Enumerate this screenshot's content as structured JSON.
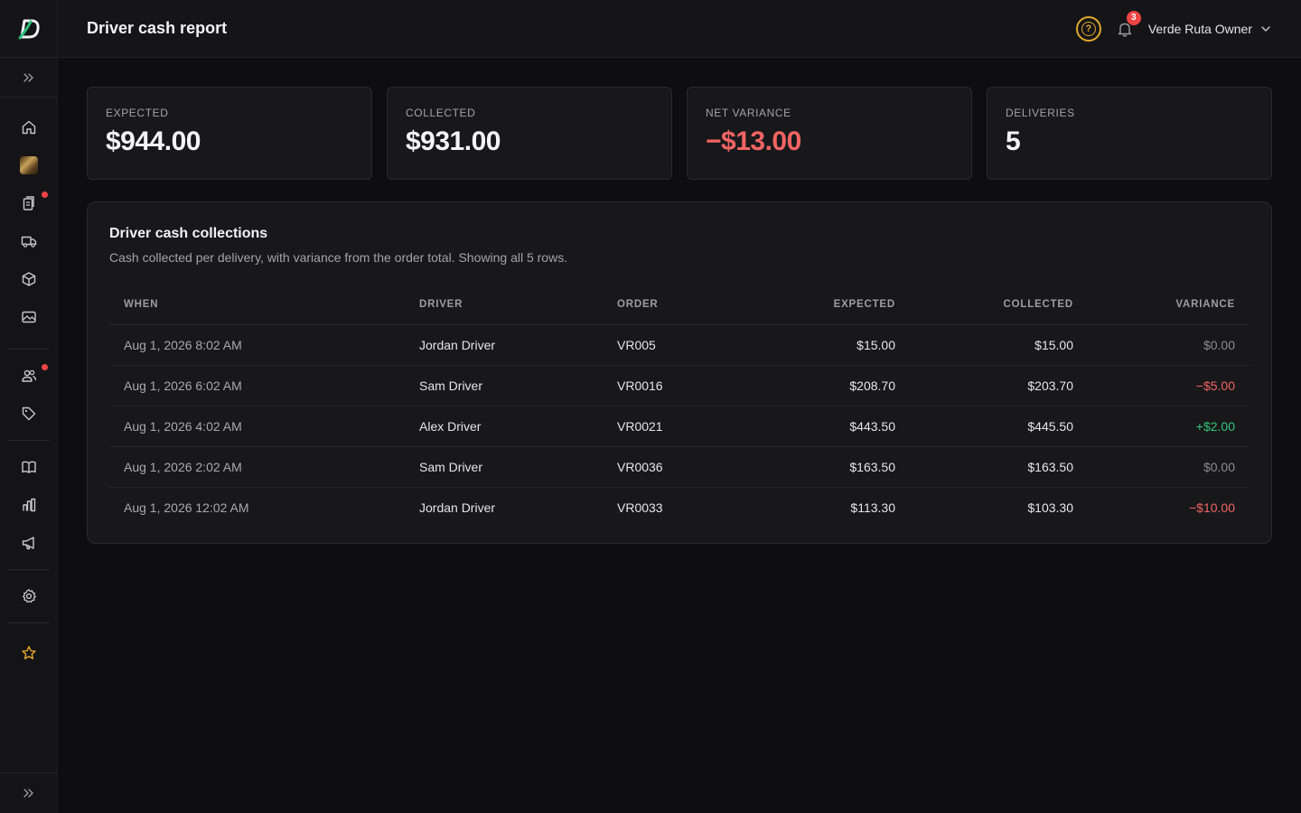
{
  "header": {
    "title": "Driver cash report",
    "notification_count": "3",
    "user_name": "Verde Ruta Owner"
  },
  "sidebar": {
    "items": [
      {
        "name": "home-icon"
      },
      {
        "name": "store-avatar"
      },
      {
        "name": "orders-icon",
        "has_dot": true
      },
      {
        "name": "delivery-truck-icon"
      },
      {
        "name": "products-box-icon"
      },
      {
        "name": "media-image-icon"
      },
      {
        "name": "customers-users-icon",
        "has_dot": true
      },
      {
        "name": "tag-icon"
      },
      {
        "name": "catalog-book-icon"
      },
      {
        "name": "analytics-bar-icon"
      },
      {
        "name": "marketing-megaphone-icon"
      },
      {
        "name": "settings-gear-icon"
      },
      {
        "name": "favorites-star-icon"
      }
    ]
  },
  "stats": [
    {
      "label": "EXPECTED",
      "value": "$944.00"
    },
    {
      "label": "COLLECTED",
      "value": "$931.00"
    },
    {
      "label": "NET VARIANCE",
      "value": "−$13.00"
    },
    {
      "label": "DELIVERIES",
      "value": "5"
    }
  ],
  "table": {
    "title": "Driver cash collections",
    "subtitle": "Cash collected per delivery, with variance from the order total. Showing all 5 rows.",
    "columns": [
      "WHEN",
      "DRIVER",
      "ORDER",
      "EXPECTED",
      "COLLECTED",
      "VARIANCE"
    ],
    "rows": [
      {
        "when": "Aug 1, 2026 8:02 AM",
        "driver": "Jordan Driver",
        "order": "VR005",
        "expected": "$15.00",
        "collected": "$15.00",
        "variance": "$0.00"
      },
      {
        "when": "Aug 1, 2026 6:02 AM",
        "driver": "Sam Driver",
        "order": "VR0016",
        "expected": "$208.70",
        "collected": "$203.70",
        "variance": "−$5.00"
      },
      {
        "when": "Aug 1, 2026 4:02 AM",
        "driver": "Alex Driver",
        "order": "VR0021",
        "expected": "$443.50",
        "collected": "$445.50",
        "variance": "+$2.00"
      },
      {
        "when": "Aug 1, 2026 2:02 AM",
        "driver": "Sam Driver",
        "order": "VR0036",
        "expected": "$163.50",
        "collected": "$163.50",
        "variance": "$0.00"
      },
      {
        "when": "Aug 1, 2026 12:02 AM",
        "driver": "Jordan Driver",
        "order": "VR0033",
        "expected": "$113.30",
        "collected": "$103.30",
        "variance": "−$10.00"
      }
    ]
  },
  "colors": {
    "accent": "#e0a82e",
    "negative": "#f26464",
    "positive": "#34c77b",
    "badge": "#ef4444"
  }
}
